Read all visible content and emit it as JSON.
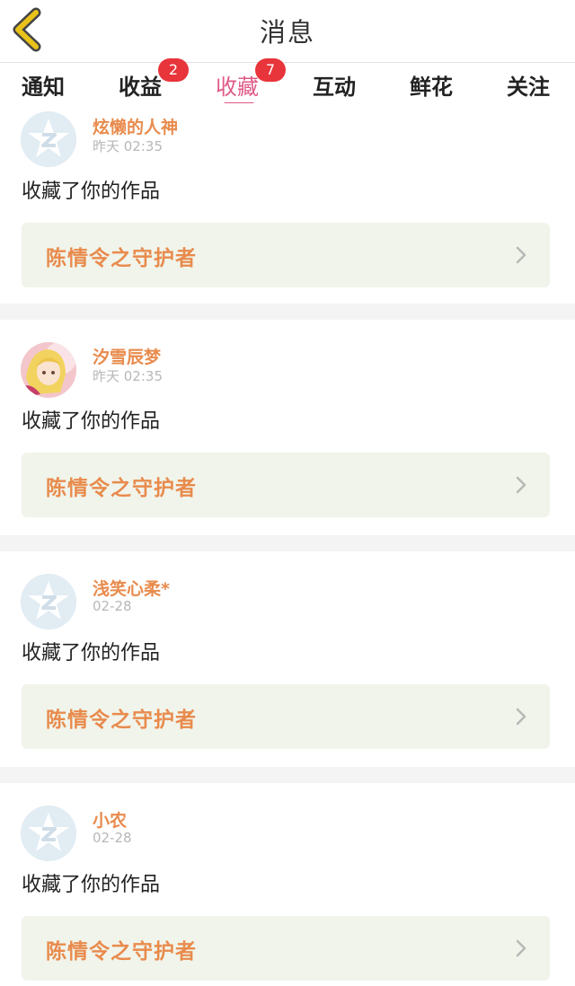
{
  "header": {
    "title": "消息",
    "back_icon": "chevron-left-icon",
    "back_color": "#e9c21a"
  },
  "tabs": [
    {
      "label": "通知",
      "badge": null,
      "active": false
    },
    {
      "label": "收益",
      "badge": "2",
      "active": false
    },
    {
      "label": "收藏",
      "badge": "7",
      "active": true
    },
    {
      "label": "互动",
      "badge": null,
      "active": false
    },
    {
      "label": "鲜花",
      "badge": null,
      "active": false
    },
    {
      "label": "关注",
      "badge": null,
      "active": false
    }
  ],
  "colors": {
    "accent": "#e05a86",
    "badge": "#e8343b",
    "username": "#e88b4d",
    "card_bg": "#f1f4ea"
  },
  "feed": [
    {
      "user": "炫懒的人神",
      "time": "昨天  02:35",
      "avatar": "default-qq-avatar-icon",
      "action": "收藏了你的作品",
      "work_title": "陈情令之守护者"
    },
    {
      "user": "汐雪辰梦",
      "time": "昨天  02:35",
      "avatar": "anime-girl-avatar",
      "action": "收藏了你的作品",
      "work_title": "陈情令之守护者"
    },
    {
      "user": "浅笑心柔*",
      "time": "02-28",
      "avatar": "default-qq-avatar-icon",
      "action": "收藏了你的作品",
      "work_title": "陈情令之守护者"
    },
    {
      "user": "小农",
      "time": "02-28",
      "avatar": "default-qq-avatar-icon",
      "action": "收藏了你的作品",
      "work_title": "陈情令之守护者"
    }
  ]
}
